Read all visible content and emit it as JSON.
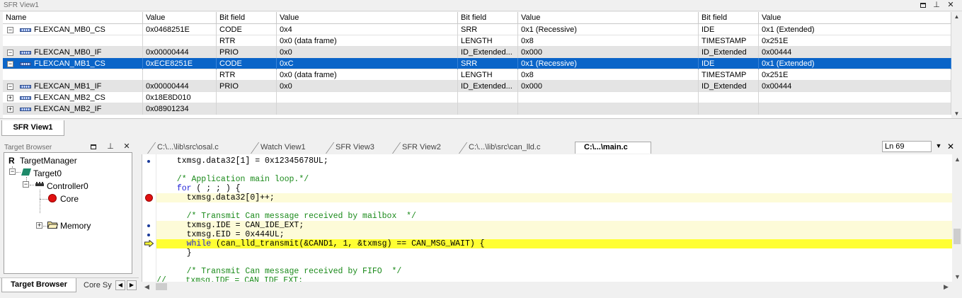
{
  "sfr": {
    "title": "SFR View1",
    "tab_label": "SFR View1",
    "columns": [
      "Name",
      "Value",
      "Bit field",
      "Value",
      "Bit field",
      "Value",
      "Bit field",
      "Value"
    ],
    "rows": [
      {
        "expander": "−",
        "name": "FLEXCAN_MB0_CS",
        "value": "0x0468251E",
        "f1": "CODE",
        "v1": "0x4",
        "f2": "SRR",
        "v2": "0x1 (Recessive)",
        "f3": "IDE",
        "v3": "0x1 (Extended)"
      },
      {
        "expander": "",
        "name": "",
        "value": "",
        "f1": "RTR",
        "v1": "0x0 (data frame)",
        "f2": "LENGTH",
        "v2": "0x8",
        "f3": "TIMESTAMP",
        "v3": "0x251E"
      },
      {
        "expander": "−",
        "name": "FLEXCAN_MB0_IF",
        "value": "0x00000444",
        "f1": "PRIO",
        "v1": "0x0",
        "f2": "ID_Extended...",
        "v2": "0x000",
        "f3": "ID_Extended",
        "v3": "0x00444"
      },
      {
        "expander": "−",
        "name": "FLEXCAN_MB1_CS",
        "value": "0xECE8251E",
        "f1": "CODE",
        "v1": "0xC",
        "f2": "SRR",
        "v2": "0x1 (Recessive)",
        "f3": "IDE",
        "v3": "0x1 (Extended)"
      },
      {
        "expander": "",
        "name": "",
        "value": "",
        "f1": "RTR",
        "v1": "0x0 (data frame)",
        "f2": "LENGTH",
        "v2": "0x8",
        "f3": "TIMESTAMP",
        "v3": "0x251E"
      },
      {
        "expander": "−",
        "name": "FLEXCAN_MB1_IF",
        "value": "0x00000444",
        "f1": "PRIO",
        "v1": "0x0",
        "f2": "ID_Extended...",
        "v2": "0x000",
        "f3": "ID_Extended",
        "v3": "0x00444"
      },
      {
        "expander": "+",
        "name": "FLEXCAN_MB2_CS",
        "value": "0x18E8D010",
        "f1": "",
        "v1": "",
        "f2": "",
        "v2": "",
        "f3": "",
        "v3": ""
      },
      {
        "expander": "+",
        "name": "FLEXCAN_MB2_IF",
        "value": "0x08901234",
        "f1": "",
        "v1": "",
        "f2": "",
        "v2": "",
        "f3": "",
        "v3": ""
      }
    ]
  },
  "target_browser": {
    "title": "Target Browser",
    "tree": {
      "root": "TargetManager",
      "target": "Target0",
      "controller": "Controller0",
      "core": "Core",
      "memory": "Memory"
    },
    "tab_active": "Target Browser",
    "tab_other": "Core Sy"
  },
  "editor": {
    "tabs": [
      "C:\\...\\lib\\src\\osal.c",
      "Watch View1",
      "SFR View3",
      "SFR View2",
      "C:\\...\\lib\\src\\can_lld.c",
      "C:\\...\\main.c"
    ],
    "line_indicator": "Ln 69",
    "lines": [
      {
        "text": "  txmsg.data32[1] = 0x12345678UL;",
        "mark": "dot",
        "hl": ""
      },
      {
        "text": "",
        "mark": "",
        "hl": ""
      },
      {
        "text": "  /* Application main loop.*/",
        "mark": "",
        "hl": "",
        "comment": true
      },
      {
        "text": "  for ( ; ; ) {",
        "mark": "",
        "hl": "",
        "kw": "for"
      },
      {
        "text": "    txmsg.data32[0]++;",
        "mark": "bp",
        "hl": "light"
      },
      {
        "text": "",
        "mark": "",
        "hl": ""
      },
      {
        "text": "    /* Transmit Can message received by mailbox  */",
        "mark": "",
        "hl": "",
        "comment": true
      },
      {
        "text": "    txmsg.IDE = CAN_IDE_EXT;",
        "mark": "dot",
        "hl": "light"
      },
      {
        "text": "    txmsg.EID = 0x444UL;",
        "mark": "dot",
        "hl": "light"
      },
      {
        "text": "    while (can_lld_transmit(&CAND1, 1, &txmsg) == CAN_MSG_WAIT) {",
        "mark": "arrow",
        "hl": "yellow",
        "kw": "while"
      },
      {
        "text": "    }",
        "mark": "",
        "hl": ""
      },
      {
        "text": "",
        "mark": "",
        "hl": ""
      },
      {
        "text": "    /* Transmit Can message received by FIFO  */",
        "mark": "",
        "hl": "",
        "comment": true
      },
      {
        "text": "//    txmsg.IDE = CAN_IDE_EXT;",
        "mark": "",
        "hl": "",
        "comment": true
      }
    ]
  },
  "colors": {
    "selection": "#0a64c8",
    "current_line": "#ffff33",
    "keyword": "#1d1dd6",
    "comment": "#1a8a1a",
    "breakpoint": "#e01010"
  }
}
